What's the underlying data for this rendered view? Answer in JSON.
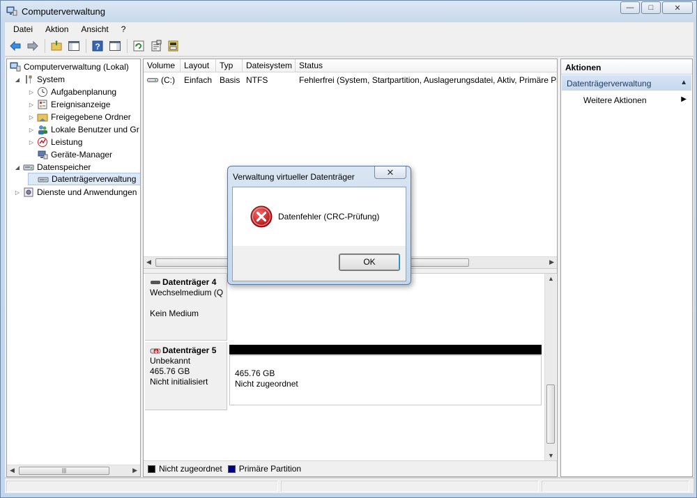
{
  "window": {
    "title": "Computerverwaltung",
    "min_glyph": "—",
    "max_glyph": "□",
    "close_glyph": "✕"
  },
  "menu": [
    "Datei",
    "Aktion",
    "Ansicht",
    "?"
  ],
  "tree": {
    "items": [
      {
        "label": "Computerverwaltung (Lokal)",
        "icon": "computer-management-icon",
        "level": 0,
        "exp": ""
      },
      {
        "label": "System",
        "icon": "system-tools-icon",
        "level": 1,
        "exp": "◢"
      },
      {
        "label": "Aufgabenplanung",
        "icon": "clock-icon",
        "level": 2,
        "exp": "▷"
      },
      {
        "label": "Ereignisanzeige",
        "icon": "event-viewer-icon",
        "level": 2,
        "exp": "▷"
      },
      {
        "label": "Freigegebene Ordner",
        "icon": "shared-folder-icon",
        "level": 2,
        "exp": "▷"
      },
      {
        "label": "Lokale Benutzer und Gr",
        "icon": "users-icon",
        "level": 2,
        "exp": "▷"
      },
      {
        "label": "Leistung",
        "icon": "performance-icon",
        "level": 2,
        "exp": "▷"
      },
      {
        "label": "Geräte-Manager",
        "icon": "device-manager-icon",
        "level": 2,
        "exp": ""
      },
      {
        "label": "Datenspeicher",
        "icon": "storage-icon",
        "level": 1,
        "exp": "◢"
      },
      {
        "label": "Datenträgerverwaltung",
        "icon": "disk-management-icon",
        "level": 2,
        "exp": "",
        "selected": true
      },
      {
        "label": "Dienste und Anwendungen",
        "icon": "services-icon",
        "level": 1,
        "exp": "▷"
      }
    ],
    "scroll_thumb": "|||"
  },
  "volume_list": {
    "columns": [
      "Volume",
      "Layout",
      "Typ",
      "Dateisystem",
      "Status"
    ],
    "rows": [
      [
        "(C:)",
        "Einfach",
        "Basis",
        "NTFS",
        "Fehlerfrei (System, Startpartition, Auslagerungsdatei, Aktiv, Primäre Pa"
      ]
    ]
  },
  "disks": [
    {
      "name": "Datenträger 4",
      "type": "Wechselmedium (Q",
      "size": "",
      "state": "Kein Medium"
    },
    {
      "name": "Datenträger 5",
      "type": "Unbekannt",
      "size": "465.76 GB",
      "state": "Nicht initialisiert",
      "partition": {
        "size": "465.76 GB",
        "state": "Nicht zugeordnet"
      }
    }
  ],
  "legend": [
    {
      "label": "Nicht zugeordnet",
      "color": "#000000"
    },
    {
      "label": "Primäre Partition",
      "color": "#00008b"
    }
  ],
  "actions": {
    "title": "Aktionen",
    "section": "Datenträgerverwaltung",
    "items": [
      "Weitere Aktionen"
    ]
  },
  "dialog": {
    "title": "Verwaltung virtueller Datenträger",
    "message": "Datenfehler (CRC-Prüfung)",
    "ok_label": "OK",
    "close_glyph": "✕",
    "icon": "error-icon"
  },
  "colors": {
    "selection": "#dde9f7",
    "error": "#c8181e",
    "accent": "#3c9fe0"
  }
}
